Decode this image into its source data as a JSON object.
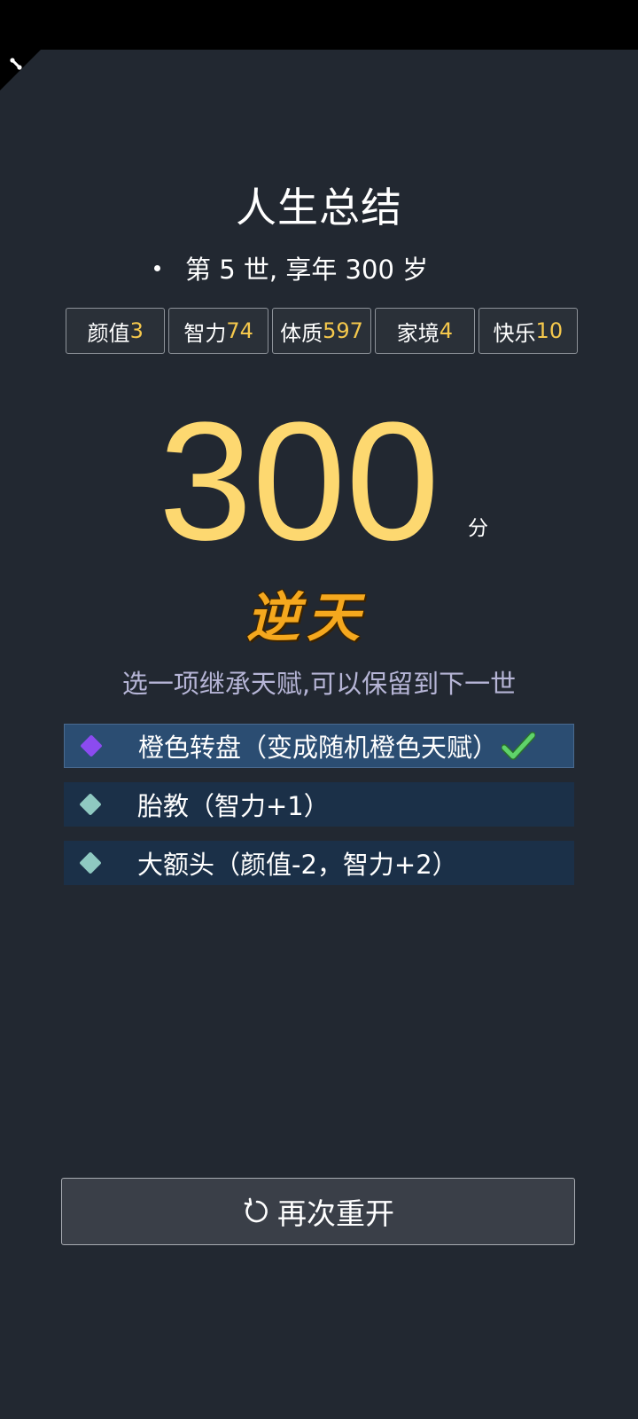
{
  "header": {
    "title": "人生总结",
    "summary": "第 5 世, 享年 300 岁"
  },
  "stats": [
    {
      "label": "颜值",
      "value": "3"
    },
    {
      "label": "智力",
      "value": "74"
    },
    {
      "label": "体质",
      "value": "597"
    },
    {
      "label": "家境",
      "value": "4"
    },
    {
      "label": "快乐",
      "value": "10"
    }
  ],
  "score": {
    "value": "300",
    "unit": "分",
    "grade": "逆天"
  },
  "inherit": {
    "hint": "选一项继承天赋,可以保留到下一世",
    "talents": [
      {
        "label": "橙色转盘（变成随机橙色天赋）",
        "color": "#8b4bf0",
        "selected": true
      },
      {
        "label": "胎教（智力+1）",
        "color": "#8fc9c1",
        "selected": false
      },
      {
        "label": "大额头（颜值-2，智力+2）",
        "color": "#8fc9c1",
        "selected": false
      }
    ]
  },
  "actions": {
    "restart_label": "再次重开",
    "restart_icon": "refresh-icon"
  },
  "colors": {
    "background": "#222831",
    "accent": "#fdd870",
    "stat_value": "#f5c84c",
    "grade": "#f5a81e",
    "check": "#5fd36a"
  }
}
